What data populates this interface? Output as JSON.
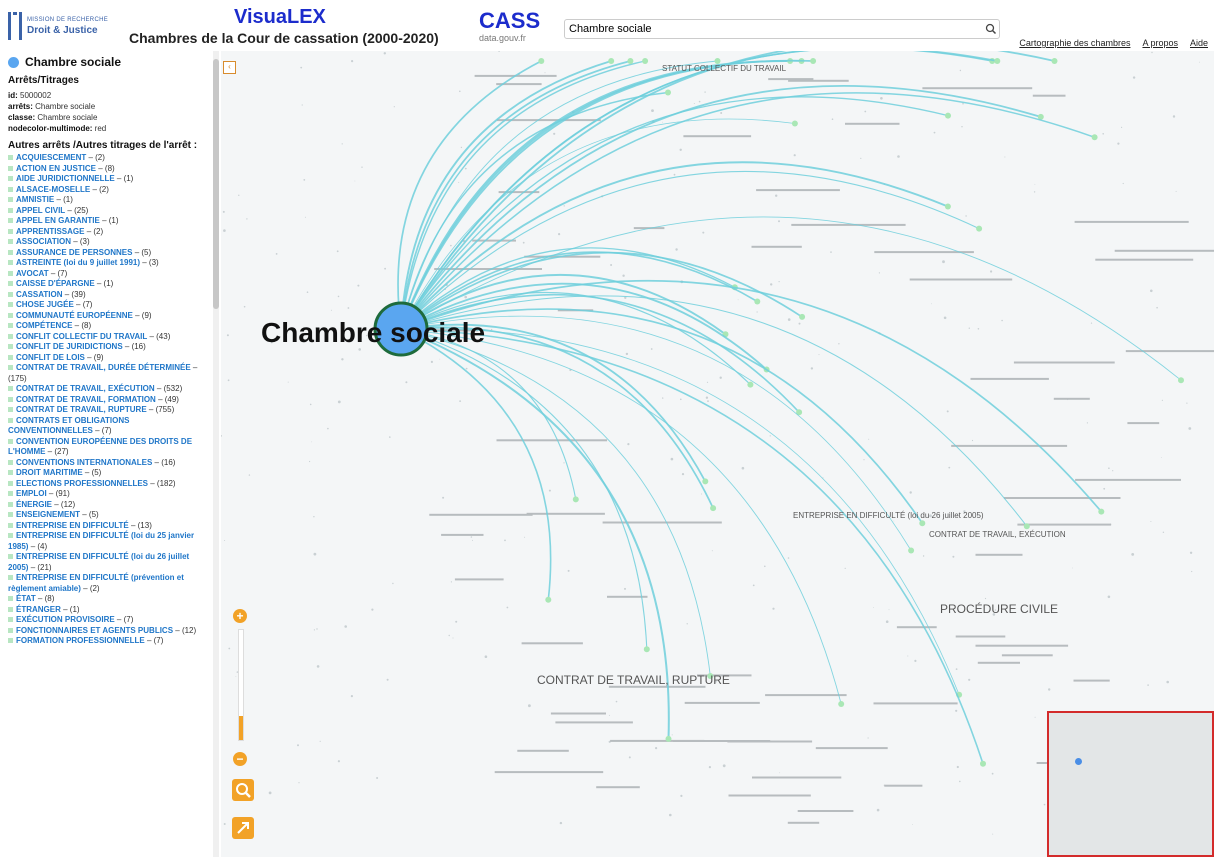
{
  "header": {
    "logo_line1": "MISSION DE RECHERCHE",
    "logo_line2": "Droit & Justice",
    "app_title": "VisuaLEX",
    "app_subtitle": "Chambres de la Cour de cassation (2000-2020)",
    "cass_title": "CASS",
    "cass_sub": "data.gouv.fr",
    "search_value": "Chambre sociale",
    "links": [
      "Cartographie des chambres",
      "A propos",
      "Aide"
    ]
  },
  "sidebar": {
    "node_name": "Chambre sociale",
    "section1": "Arrêts/Titrages",
    "meta": [
      {
        "key": "id:",
        "value": "5000002"
      },
      {
        "key": "arrêts:",
        "value": "Chambre sociale"
      },
      {
        "key": "classe:",
        "value": "Chambre sociale"
      },
      {
        "key": "nodecolor-multimode:",
        "value": "red"
      }
    ],
    "section2": "Autres arrêts /Autres titrages de l'arrêt :",
    "items": [
      {
        "label": "ACQUIESCEMENT",
        "count": " – (2)"
      },
      {
        "label": "ACTION EN JUSTICE",
        "count": " – (8)"
      },
      {
        "label": "AIDE JURIDICTIONNELLE",
        "count": " – (1)"
      },
      {
        "label": "ALSACE-MOSELLE",
        "count": " – (2)"
      },
      {
        "label": "AMNISTIE",
        "count": " – (1)"
      },
      {
        "label": "APPEL CIVIL",
        "count": " – (25)"
      },
      {
        "label": "APPEL EN GARANTIE",
        "count": " – (1)"
      },
      {
        "label": "APPRENTISSAGE",
        "count": " – (2)"
      },
      {
        "label": "ASSOCIATION",
        "count": " – (3)"
      },
      {
        "label": "ASSURANCE DE PERSONNES",
        "count": " – (5)"
      },
      {
        "label": "ASTREINTE (loi du 9 juillet 1991)",
        "count": " – (3)"
      },
      {
        "label": "AVOCAT",
        "count": " – (7)"
      },
      {
        "label": "CAISSE D'ÉPARGNE",
        "count": " – (1)"
      },
      {
        "label": "CASSATION",
        "count": " – (39)"
      },
      {
        "label": "CHOSE JUGÉE",
        "count": " – (7)"
      },
      {
        "label": "COMMUNAUTÉ EUROPÉENNE",
        "count": " – (9)"
      },
      {
        "label": "COMPÉTENCE",
        "count": " – (8)"
      },
      {
        "label": "CONFLIT COLLECTIF DU TRAVAIL",
        "count": " – (43)"
      },
      {
        "label": "CONFLIT DE JURIDICTIONS",
        "count": " – (16)"
      },
      {
        "label": "CONFLIT DE LOIS",
        "count": " – (9)"
      },
      {
        "label": "CONTRAT DE TRAVAIL, DURÉE DÉTERMINÉE",
        "count": " – (175)"
      },
      {
        "label": "CONTRAT DE TRAVAIL, EXÉCUTION",
        "count": " – (532)"
      },
      {
        "label": "CONTRAT DE TRAVAIL, FORMATION",
        "count": " – (49)"
      },
      {
        "label": "CONTRAT DE TRAVAIL, RUPTURE",
        "count": " – (755)"
      },
      {
        "label": "CONTRATS ET OBLIGATIONS CONVENTIONNELLES",
        "count": " – (7)"
      },
      {
        "label": "CONVENTION EUROPÉENNE DES DROITS DE L'HOMME",
        "count": " – (27)"
      },
      {
        "label": "CONVENTIONS INTERNATIONALES",
        "count": " – (16)"
      },
      {
        "label": "DROIT MARITIME",
        "count": " – (5)"
      },
      {
        "label": "ELECTIONS PROFESSIONNELLES",
        "count": " – (182)"
      },
      {
        "label": "EMPLOI",
        "count": " – (91)"
      },
      {
        "label": "ÉNERGIE",
        "count": " – (12)"
      },
      {
        "label": "ENSEIGNEMENT",
        "count": " – (5)"
      },
      {
        "label": "ENTREPRISE EN DIFFICULTÉ",
        "count": " – (13)"
      },
      {
        "label": "ENTREPRISE EN DIFFICULTÉ (loi du 25 janvier 1985)",
        "count": " – (4)"
      },
      {
        "label": "ENTREPRISE EN DIFFICULTÉ (loi du 26 juillet 2005)",
        "count": " – (21)"
      },
      {
        "label": "ENTREPRISE EN DIFFICULTÉ (prévention et règlement amiable)",
        "count": " – (2)"
      },
      {
        "label": "ÉTAT",
        "count": " – (8)"
      },
      {
        "label": "ÉTRANGER",
        "count": " – (1)"
      },
      {
        "label": "EXÉCUTION PROVISOIRE",
        "count": " – (7)"
      },
      {
        "label": "FONCTIONNAIRES ET AGENTS PUBLICS",
        "count": " – (12)"
      },
      {
        "label": "FORMATION PROFESSIONNELLE",
        "count": " – (7)"
      }
    ]
  },
  "graph": {
    "center_label": "Chambre sociale",
    "collapse": "‹",
    "labels": [
      {
        "text": "STATUT COLLECTIF DU TRAVAIL",
        "size": "medium"
      },
      {
        "text": "ENTREPRISE EN DIFFICULTÉ (loi du 26 juillet 2005)",
        "size": "medium"
      },
      {
        "text": "CONTRAT DE TRAVAIL, EXÉCUTION",
        "size": "medium"
      },
      {
        "text": "PROCÉDURE CIVILE",
        "size": "large"
      },
      {
        "text": "CONTRAT DE TRAVAIL, RUPTURE",
        "size": "large"
      }
    ],
    "zoom_level": 0.22
  },
  "colors": {
    "edge": "#6fcfdc",
    "center_node": "#5aa6f0",
    "accent": "#f2a227",
    "minimap_border": "#d32b2b"
  }
}
